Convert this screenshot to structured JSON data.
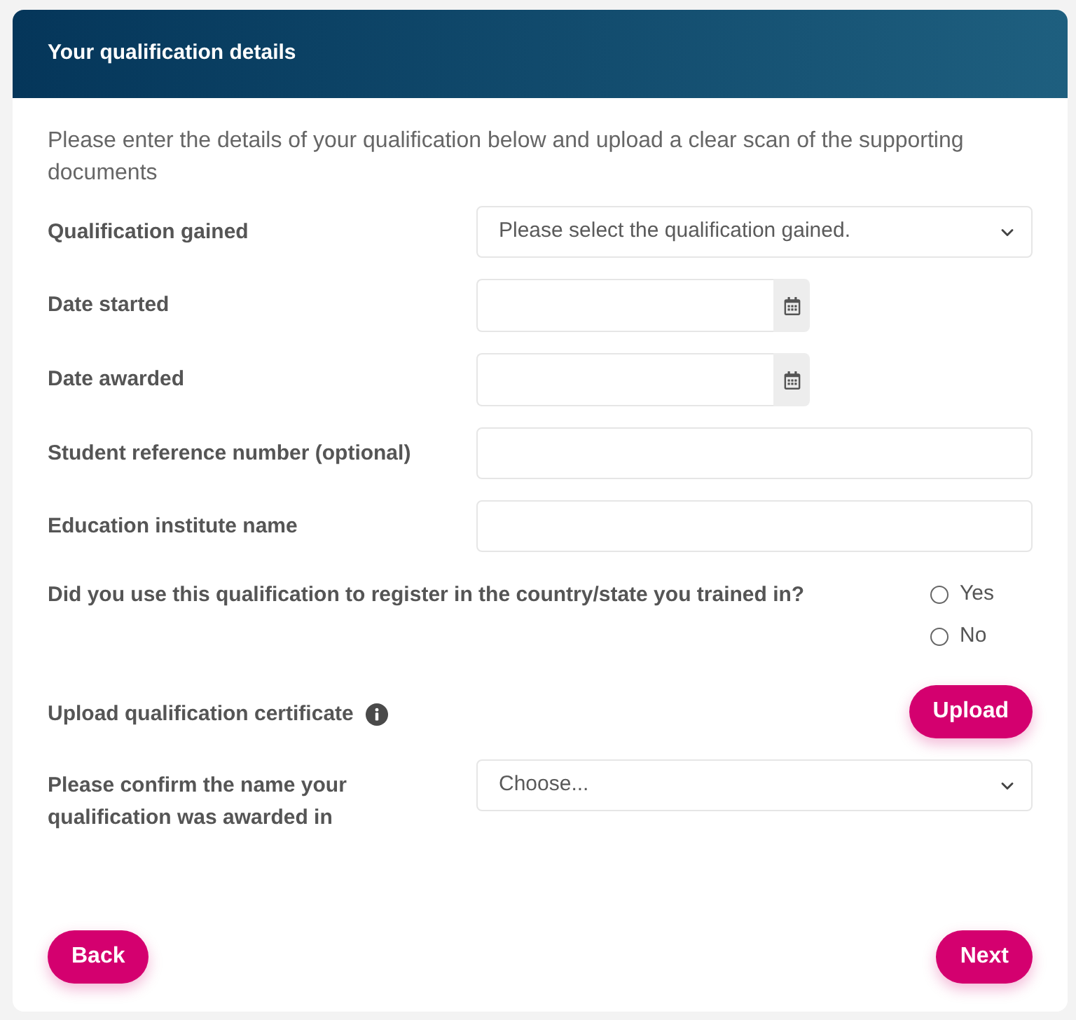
{
  "header": {
    "title": "Your qualification details"
  },
  "intro": "Please enter the details of your qualification below and upload a clear scan of the supporting documents",
  "fields": [
    {
      "kind": "select",
      "label": "Qualification gained",
      "placeholder": "Please select the qualification gained."
    },
    {
      "kind": "date",
      "label": "Date started"
    },
    {
      "kind": "date",
      "label": "Date awarded"
    },
    {
      "kind": "text",
      "label": "Student reference number (optional)"
    },
    {
      "kind": "text",
      "label": "Education institute name"
    },
    {
      "kind": "radio",
      "label": "Did you use this qualification to register in the country/state you trained in?",
      "options": [
        {
          "label": "Yes",
          "selected": false
        },
        {
          "label": "No",
          "selected": false
        }
      ]
    },
    {
      "kind": "upload",
      "label": "Upload qualification certificate",
      "button": "Upload"
    },
    {
      "kind": "select",
      "label": "Please confirm the name your qualification was awarded in",
      "placeholder": "Choose..."
    }
  ],
  "footer": {
    "back": "Back",
    "next": "Next"
  }
}
